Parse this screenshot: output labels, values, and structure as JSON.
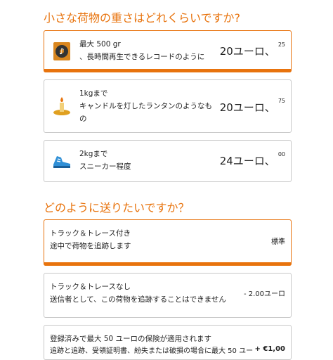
{
  "section1": {
    "title": "小さな荷物の重さはどれくらいですか?",
    "options": [
      {
        "line1": "最大 500 gr",
        "line2": "、長時間再生できるレコードのように",
        "price_main": "20ユーロ、",
        "price_sup": "25",
        "icon": "vinyl-record-icon"
      },
      {
        "line1": "1kgまで",
        "line2": "キャンドルを灯したランタンのようなも",
        "line3": "の",
        "price_main": "20ユーロ、",
        "price_sup": "75",
        "icon": "candle-lantern-icon"
      },
      {
        "line1": "2kgまで",
        "line2": "スニーカー程度",
        "price_main": "24ユーロ、",
        "price_sup": "00",
        "icon": "sneaker-icon"
      }
    ]
  },
  "section2": {
    "title": "どのように送りたいですか？",
    "options": [
      {
        "line1": "トラック＆トレース付き",
        "line2": "途中で荷物を追跡します",
        "price": "標準"
      },
      {
        "line1": "トラック＆トレースなし",
        "line2": "送信者として、この荷物を追跡することはできません",
        "price": "- 2.00ユーロ"
      },
      {
        "line1": "登録済みで最大 50 ユーロの保険が適用されます",
        "line2": "追跡と追跡、受領証明書、紛失または破損の場合に最大 50 ユー",
        "price": "+ €1,00"
      }
    ]
  },
  "colors": {
    "accent": "#e8730d",
    "border": "#c8c8c8"
  }
}
